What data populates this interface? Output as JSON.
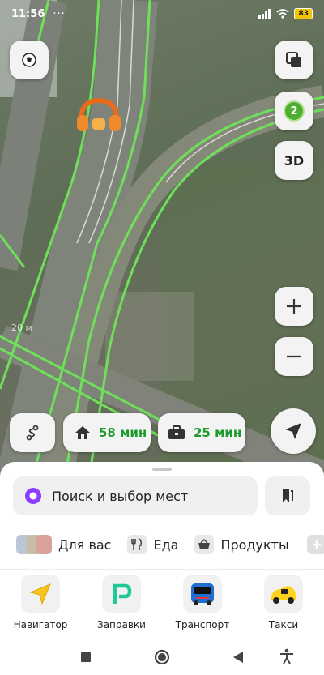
{
  "status_bar": {
    "time": "11:56",
    "dots": "···",
    "battery": "83"
  },
  "map": {
    "three_d_label": "3D",
    "badge_count": "2",
    "scale_label": "20 м",
    "home_eta": "58 мин",
    "work_eta": "25 мин"
  },
  "search": {
    "placeholder": "Поиск и выбор мест"
  },
  "categories": [
    {
      "label": "Для вас"
    },
    {
      "label": "Еда"
    },
    {
      "label": "Продукты"
    }
  ],
  "apps": [
    {
      "label": "Навигатор"
    },
    {
      "label": "Заправки"
    },
    {
      "label": "Транспорт"
    },
    {
      "label": "Такси"
    }
  ],
  "colors": {
    "route_green": "#6fe05a",
    "eta_green": "#1d9a2b",
    "alice_purple": "#8a3ffc",
    "badge_green": "#4caf2f"
  }
}
